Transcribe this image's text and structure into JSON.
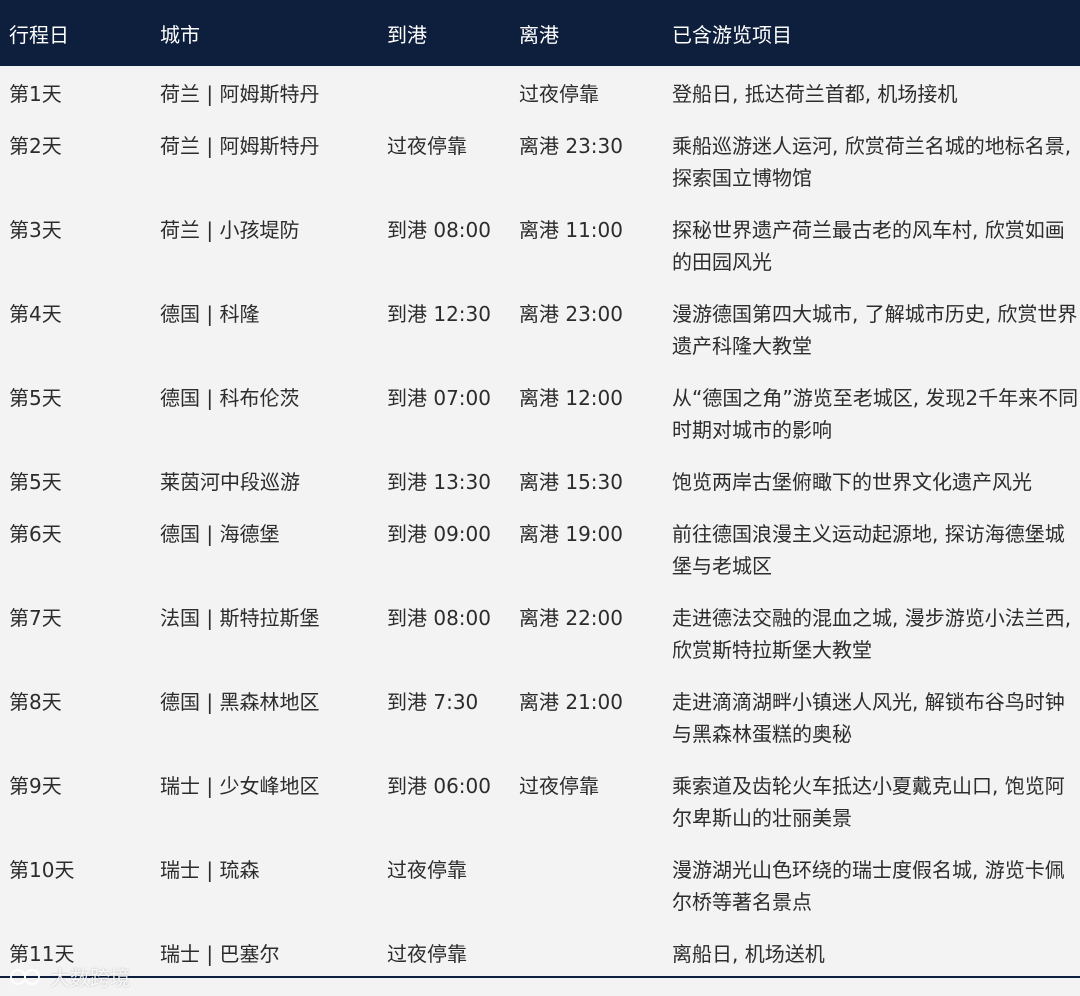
{
  "table": {
    "headers": [
      "行程日",
      "城市",
      "到港",
      "离港",
      "已含游览项目"
    ],
    "rows": [
      {
        "day": "第1天",
        "city": "荷兰 | 阿姆斯特丹",
        "arrive": "",
        "depart": "过夜停靠",
        "desc": "登船日, 抵达荷兰首都, 机场接机"
      },
      {
        "day": "第2天",
        "city": "荷兰 | 阿姆斯特丹",
        "arrive": "过夜停靠",
        "depart": "离港 23:30",
        "desc": "乘船巡游迷人运河, 欣赏荷兰名城的地标名景, 探索国立博物馆"
      },
      {
        "day": "第3天",
        "city": "荷兰 | 小孩堤防",
        "arrive": "到港 08:00",
        "depart": "离港 11:00",
        "desc": "探秘世界遗产荷兰最古老的风车村, 欣赏如画的田园风光"
      },
      {
        "day": "第4天",
        "city": "德国 | 科隆",
        "arrive": "到港 12:30",
        "depart": "离港 23:00",
        "desc": "漫游德国第四大城市, 了解城市历史, 欣赏世界遗产科隆大教堂"
      },
      {
        "day": "第5天",
        "city": "德国 | 科布伦茨",
        "arrive": "到港 07:00",
        "depart": "离港 12:00",
        "desc": "从“德国之角”游览至老城区, 发现2千年来不同时期对城市的影响"
      },
      {
        "day": "第5天",
        "city": "莱茵河中段巡游",
        "arrive": "到港 13:30",
        "depart": "离港 15:30",
        "desc": "饱览两岸古堡俯瞰下的世界文化遗产风光"
      },
      {
        "day": "第6天",
        "city": "德国 | 海德堡",
        "arrive": "到港 09:00",
        "depart": "离港 19:00",
        "desc": "前往德国浪漫主义运动起源地, 探访海德堡城堡与老城区"
      },
      {
        "day": "第7天",
        "city": "法国 | 斯特拉斯堡",
        "arrive": "到港 08:00",
        "depart": "离港 22:00",
        "desc": "走进德法交融的混血之城, 漫步游览小法兰西, 欣赏斯特拉斯堡大教堂"
      },
      {
        "day": "第8天",
        "city": "德国 | 黑森林地区",
        "arrive": "到港 7:30",
        "depart": "离港 21:00",
        "desc": "走进滴滴湖畔小镇迷人风光, 解锁布谷鸟时钟与黑森林蛋糕的奥秘"
      },
      {
        "day": "第9天",
        "city": "瑞士 | 少女峰地区",
        "arrive": "到港 06:00",
        "depart": "过夜停靠",
        "desc": "乘索道及齿轮火车抵达小夏戴克山口, 饱览阿尔卑斯山的壮丽美景"
      },
      {
        "day": "第10天",
        "city": "瑞士 | 琉森",
        "arrive": "过夜停靠",
        "depart": "",
        "desc": "漫游湖光山色环绕的瑞士度假名城, 游览卡佩尔桥等著名景点"
      },
      {
        "day": "第11天",
        "city": "瑞士 | 巴塞尔",
        "arrive": "过夜停靠",
        "depart": "",
        "desc": "离船日, 机场送机"
      }
    ]
  },
  "watermark": {
    "text": "大数跨境"
  },
  "colors": {
    "header_bg": "#0d1f3c",
    "page_bg": "#f3f3f4"
  }
}
